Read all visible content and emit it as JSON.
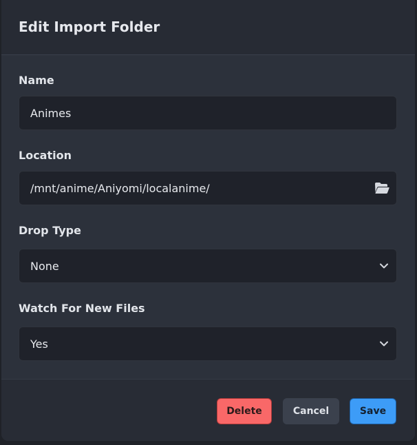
{
  "dialog": {
    "title": "Edit Import Folder"
  },
  "fields": {
    "name": {
      "label": "Name",
      "value": "Animes"
    },
    "location": {
      "label": "Location",
      "value": "/mnt/anime/Aniyomi/localanime/",
      "icon": "folder-open-icon"
    },
    "drop_type": {
      "label": "Drop Type",
      "value": "None",
      "icon": "chevron-down-icon"
    },
    "watch": {
      "label": "Watch For New Files",
      "value": "Yes",
      "icon": "chevron-down-icon"
    }
  },
  "footer": {
    "delete_label": "Delete",
    "cancel_label": "Cancel",
    "save_label": "Save"
  },
  "colors": {
    "delete": "#f96868",
    "save": "#3d9cf7",
    "cancel": "#3b414d"
  }
}
